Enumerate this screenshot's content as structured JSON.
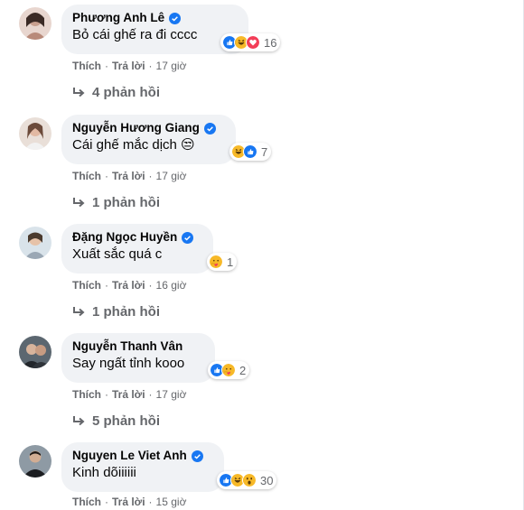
{
  "comments": [
    {
      "author": "Phương Anh Lê",
      "text": "Bỏ cái ghế ra đi cccc",
      "reactions": [
        "like-icon",
        "haha-icon",
        "love-icon"
      ],
      "reaction_count": "16",
      "like_label": "Thích",
      "reply_label": "Trả lời",
      "time": "17 giờ",
      "replies_label": "4 phản hồi"
    },
    {
      "author": "Nguyễn Hương Giang",
      "text": "Cái ghế mắc dịch 😒",
      "reactions": [
        "haha-icon",
        "like-icon"
      ],
      "reaction_count": "7",
      "like_label": "Thích",
      "reply_label": "Trả lời",
      "time": "17 giờ",
      "replies_label": "1 phản hồi"
    },
    {
      "author": "Đặng Ngọc Huyền",
      "text": "Xuất sắc quá c",
      "reactions": [
        "care-icon"
      ],
      "reaction_count": "1",
      "like_label": "Thích",
      "reply_label": "Trả lời",
      "time": "16 giờ",
      "replies_label": "1 phản hồi"
    },
    {
      "author": "Nguyễn Thanh Vân",
      "text": "Say ngất tỉnh kooo",
      "reactions": [
        "like-icon",
        "care-icon"
      ],
      "reaction_count": "2",
      "like_label": "Thích",
      "reply_label": "Trả lời",
      "time": "17 giờ",
      "replies_label": "5 phản hồi"
    },
    {
      "author": "Nguyen Le Viet Anh",
      "text": "Kinh dõiiiiii",
      "reactions": [
        "like-icon",
        "haha-icon",
        "wow-icon"
      ],
      "reaction_count": "30",
      "like_label": "Thích",
      "reply_label": "Trả lời",
      "time": "15 giờ"
    }
  ],
  "colors": {
    "like": "#1877f2",
    "love": "#f33e58",
    "haha": "#f7b928",
    "verified": "#1877f2",
    "secondary_text": "#65676b",
    "bubble": "#f0f2f5"
  }
}
